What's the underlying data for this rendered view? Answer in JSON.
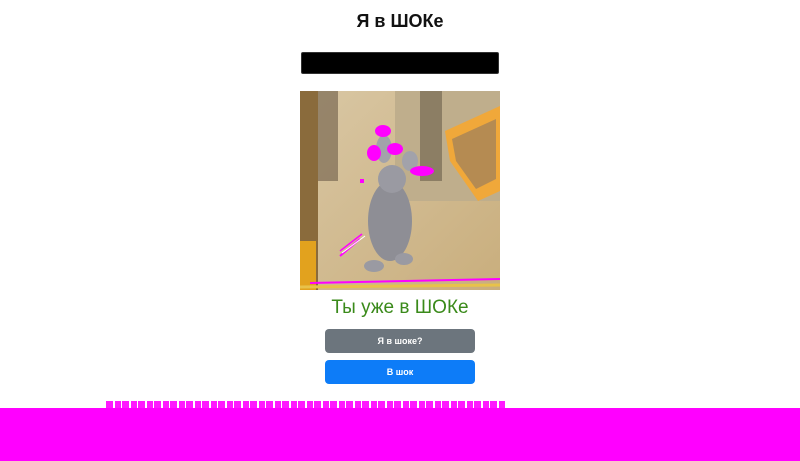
{
  "page": {
    "title": "Я в ШОКе",
    "status_text": "Ты уже в ШОКе"
  },
  "input": {
    "value": ""
  },
  "photo": {
    "icon": "shocked-hamster-image"
  },
  "buttons": {
    "am_i_shocked": "Я в шоке?",
    "to_shock": "В шок"
  },
  "colors": {
    "status_green": "#3a8a1a",
    "button_gray": "#6c757d",
    "button_blue": "#0d7cf8",
    "artifact_magenta": "#ff00ff"
  }
}
